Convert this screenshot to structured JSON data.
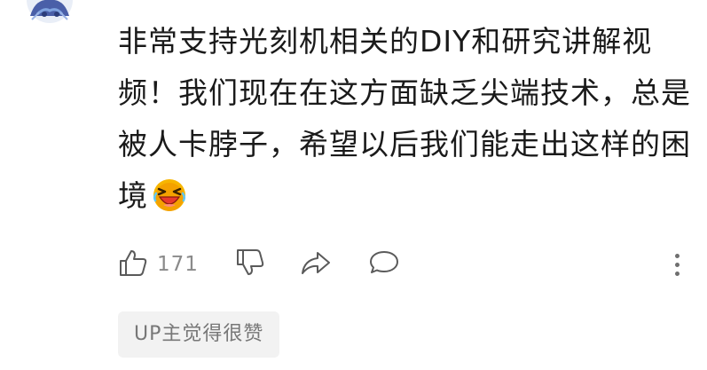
{
  "comment": {
    "lines": [
      "非常支持光刻机相关的DIY和研究讲解视",
      "频！我们现在在这方面缺乏尖端技术，总是",
      "被人卡脖子，希望以后我们能走出这样的困",
      "境"
    ],
    "emoji": "laughing-crying-emoji"
  },
  "actions": {
    "like_count": "171",
    "icons": [
      "thumbs-up-icon",
      "thumbs-down-icon",
      "share-icon",
      "comment-icon",
      "more-icon"
    ]
  },
  "badge": {
    "label": "UP主觉得很赞"
  },
  "colors": {
    "text": "#1a1a1a",
    "muted": "#8a8a8a",
    "badge_bg": "#f2f2f2",
    "emoji_red": "#e8392b",
    "emoji_yellow": "#f7b500"
  }
}
